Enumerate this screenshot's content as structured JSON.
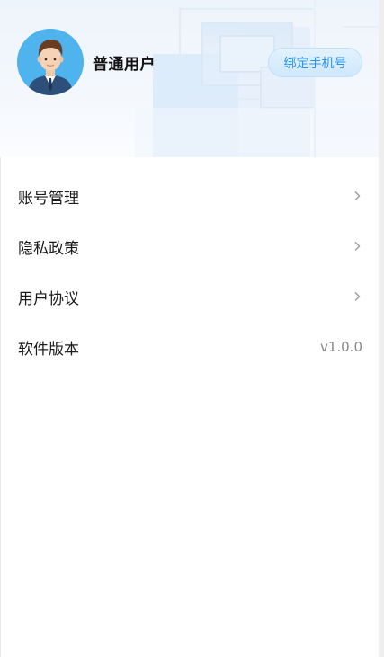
{
  "profile": {
    "username": "普通用户",
    "avatar_icon": "user-avatar-icon",
    "bind_phone_label": "绑定手机号"
  },
  "menu": {
    "items": [
      {
        "label": "账号管理",
        "trailing": "chevron-right-icon"
      },
      {
        "label": "隐私政策",
        "trailing": "chevron-right-icon"
      },
      {
        "label": "用户协议",
        "trailing": "chevron-right-icon"
      },
      {
        "label": "软件版本",
        "value": "v1.0.0"
      }
    ]
  },
  "colors": {
    "accent": "#2a93e6",
    "header_bg": "#eef4fb",
    "avatar_bg": "#4fb3ee"
  }
}
